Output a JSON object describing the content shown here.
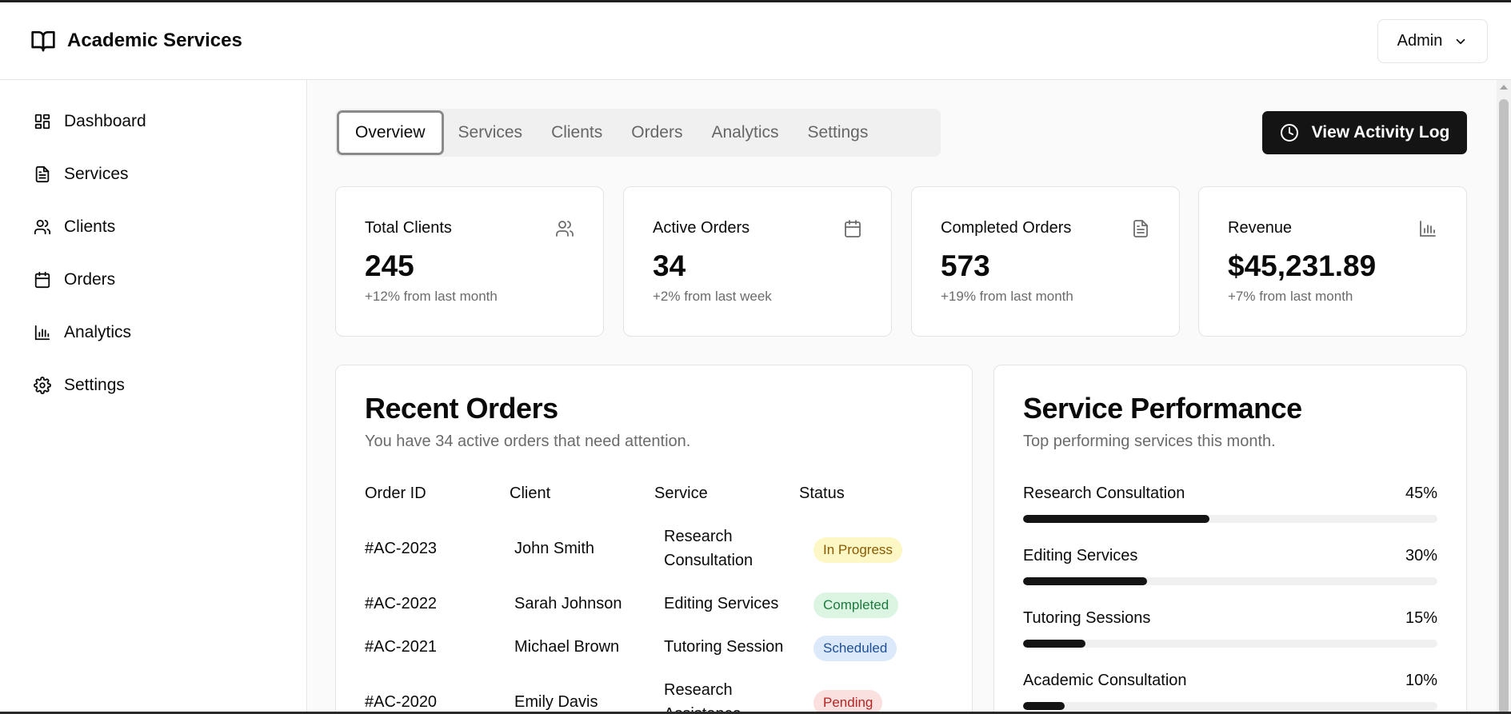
{
  "app": {
    "title": "Academic Services",
    "user_menu_label": "Admin"
  },
  "sidebar": {
    "items": [
      {
        "label": "Dashboard",
        "icon": "dashboard-icon"
      },
      {
        "label": "Services",
        "icon": "file-text-icon"
      },
      {
        "label": "Clients",
        "icon": "users-icon"
      },
      {
        "label": "Orders",
        "icon": "calendar-icon"
      },
      {
        "label": "Analytics",
        "icon": "bar-chart-icon"
      },
      {
        "label": "Settings",
        "icon": "gear-icon"
      }
    ]
  },
  "tabs": [
    {
      "label": "Overview",
      "active": true
    },
    {
      "label": "Services",
      "active": false
    },
    {
      "label": "Clients",
      "active": false
    },
    {
      "label": "Orders",
      "active": false
    },
    {
      "label": "Analytics",
      "active": false
    },
    {
      "label": "Settings",
      "active": false
    }
  ],
  "actions": {
    "activity_log_label": "View Activity Log"
  },
  "stats": [
    {
      "label": "Total Clients",
      "value": "245",
      "change": "+12% from last month",
      "icon": "users-icon"
    },
    {
      "label": "Active Orders",
      "value": "34",
      "change": "+2% from last week",
      "icon": "calendar-icon"
    },
    {
      "label": "Completed Orders",
      "value": "573",
      "change": "+19% from last month",
      "icon": "file-text-icon"
    },
    {
      "label": "Revenue",
      "value": "$45,231.89",
      "change": "+7% from last month",
      "icon": "bar-chart-icon"
    }
  ],
  "recent_orders": {
    "title": "Recent Orders",
    "subtitle": "You have 34 active orders that need attention.",
    "columns": [
      "Order ID",
      "Client",
      "Service",
      "Status"
    ],
    "rows": [
      {
        "id": "#AC-2023",
        "client": "John Smith",
        "service": "Research Consultation",
        "status": "In Progress"
      },
      {
        "id": "#AC-2022",
        "client": "Sarah Johnson",
        "service": "Editing Services",
        "status": "Completed"
      },
      {
        "id": "#AC-2021",
        "client": "Michael Brown",
        "service": "Tutoring Session",
        "status": "Scheduled"
      },
      {
        "id": "#AC-2020",
        "client": "Emily Davis",
        "service": "Research Assistance",
        "status": "Pending"
      }
    ],
    "status_colors": {
      "In Progress": "#fdf6c5",
      "Completed": "#dcf5e3",
      "Scheduled": "#dbe9fb",
      "Pending": "#fbe0e0"
    }
  },
  "service_performance": {
    "title": "Service Performance",
    "subtitle": "Top performing services this month.",
    "items": [
      {
        "label": "Research Consultation",
        "percent_label": "45%",
        "value": 45
      },
      {
        "label": "Editing Services",
        "percent_label": "30%",
        "value": 30
      },
      {
        "label": "Tutoring Sessions",
        "percent_label": "15%",
        "value": 15
      },
      {
        "label": "Academic Consultation",
        "percent_label": "10%",
        "value": 10
      }
    ]
  },
  "colors": {
    "primary": "#141414",
    "muted_text": "#6b6b6b",
    "border": "#e4e4e4"
  }
}
